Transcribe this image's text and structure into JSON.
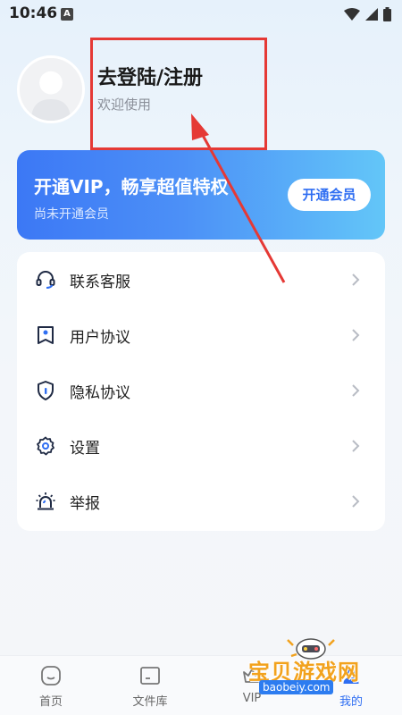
{
  "status_bar": {
    "time": "10:46",
    "notification_letter": "A",
    "icons": [
      "wifi-icon",
      "signal-icon",
      "battery-icon"
    ]
  },
  "profile": {
    "login_title": "去登陆/注册",
    "welcome_text": "欢迎使用"
  },
  "vip_card": {
    "title": "开通VIP，畅享超值特权",
    "subtitle": "尚未开通会员",
    "button_label": "开通会员",
    "gradient_start": "#3c78f5",
    "gradient_end": "#63c6f8"
  },
  "menu": {
    "items": [
      {
        "label": "联系客服",
        "icon": "headset-icon"
      },
      {
        "label": "用户协议",
        "icon": "user-agreement-icon"
      },
      {
        "label": "隐私协议",
        "icon": "privacy-shield-icon"
      },
      {
        "label": "设置",
        "icon": "settings-gear-icon"
      },
      {
        "label": "举报",
        "icon": "report-alarm-icon"
      }
    ]
  },
  "bottom_nav": {
    "items": [
      {
        "label": "首页",
        "icon": "home-icon",
        "active": false
      },
      {
        "label": "文件库",
        "icon": "folder-icon",
        "active": false
      },
      {
        "label": "VIP",
        "icon": "vip-crown-icon",
        "active": false
      },
      {
        "label": "我的",
        "icon": "profile-icon",
        "active": true
      }
    ]
  },
  "watermark": {
    "text": "宝贝游戏网",
    "url": "baobeiy.com"
  },
  "colors": {
    "accent": "#2f6ef2",
    "annotation_red": "#e53935"
  }
}
